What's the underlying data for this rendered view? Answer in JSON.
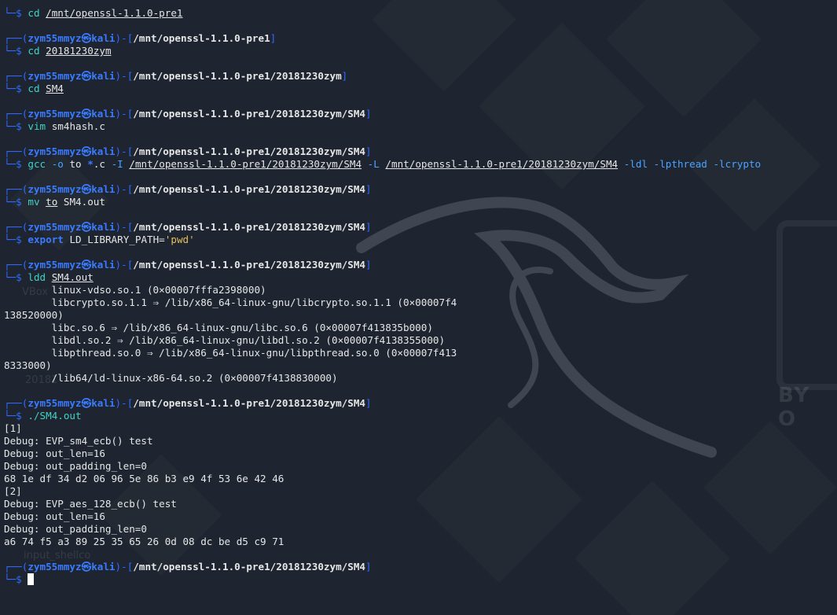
{
  "prompt": {
    "user": "zym55mmyz",
    "host": "kali",
    "at_symbol": "㉿",
    "dollar": "$"
  },
  "first_line": {
    "cmd": "cd",
    "arg": "/mnt/openssl-1.1.0-pre1"
  },
  "blocks": [
    {
      "path": "/mnt/openssl-1.1.0-pre1",
      "cmd": "cd",
      "arg": "20181230zym"
    },
    {
      "path": "/mnt/openssl-1.1.0-pre1/20181230zym",
      "cmd": "cd",
      "arg": "SM4"
    },
    {
      "path": "/mnt/openssl-1.1.0-pre1/20181230zym/SM4",
      "cmd": "vim",
      "arg": "sm4hash.c"
    },
    {
      "path": "/mnt/openssl-1.1.0-pre1/20181230zym/SM4",
      "cmd": "gcc",
      "flag_o": "-o",
      "arg_to": "to",
      "glob": "*",
      "glob_ext": ".c",
      "flag_I": "-I",
      "include_path": "/mnt/openssl-1.1.0-pre1/20181230zym/SM4",
      "flag_L": "-L",
      "lib_path": "/mnt/openssl-1.1.0-pre1/20181230zym/SM4",
      "libs": "-ldl -lpthread -lcrypto"
    },
    {
      "path": "/mnt/openssl-1.1.0-pre1/20181230zym/SM4",
      "cmd": "mv",
      "arg1": "to",
      "arg2": "SM4.out"
    },
    {
      "path": "/mnt/openssl-1.1.0-pre1/20181230zym/SM4",
      "cmd": "export",
      "arg": "LD_LIBRARY_PATH=",
      "str": "'pwd'"
    },
    {
      "path": "/mnt/openssl-1.1.0-pre1/20181230zym/SM4",
      "cmd": "ldd",
      "arg": "SM4.out",
      "output": [
        "        linux-vdso.so.1 (0×00007fffa2398000)",
        "        libcrypto.so.1.1 ⇒ /lib/x86_64-linux-gnu/libcrypto.so.1.1 (0×00007f4",
        "138520000)",
        "        libc.so.6 ⇒ /lib/x86_64-linux-gnu/libc.so.6 (0×00007f413835b000)",
        "        libdl.so.2 ⇒ /lib/x86_64-linux-gnu/libdl.so.2 (0×00007f4138355000)",
        "        libpthread.so.0 ⇒ /lib/x86_64-linux-gnu/libpthread.so.0 (0×00007f413",
        "8333000)",
        "        /lib64/ld-linux-x86-64.so.2 (0×00007f4138830000)"
      ]
    },
    {
      "path": "/mnt/openssl-1.1.0-pre1/20181230zym/SM4",
      "cmd": "./SM4.out",
      "output": [
        "[1]",
        "Debug: EVP_sm4_ecb() test",
        "Debug: out_len=16",
        "Debug: out_padding_len=0",
        "68 1e df 34 d2 06 96 5e 86 b3 e9 4f 53 6e 42 46",
        "[2]",
        "Debug: EVP_aes_128_ecb() test",
        "Debug: out_len=16",
        "Debug: out_padding_len=0",
        "a6 74 f5 a3 89 25 35 65 26 0d 08 dc be d5 c9 71"
      ]
    }
  ],
  "final_prompt": {
    "path": "/mnt/openssl-1.1.0-pre1/20181230zym/SM4"
  },
  "background": {
    "ghost_labels": [
      "VBox",
      "20181",
      "input_shellco"
    ],
    "brand_text": "BY O"
  }
}
